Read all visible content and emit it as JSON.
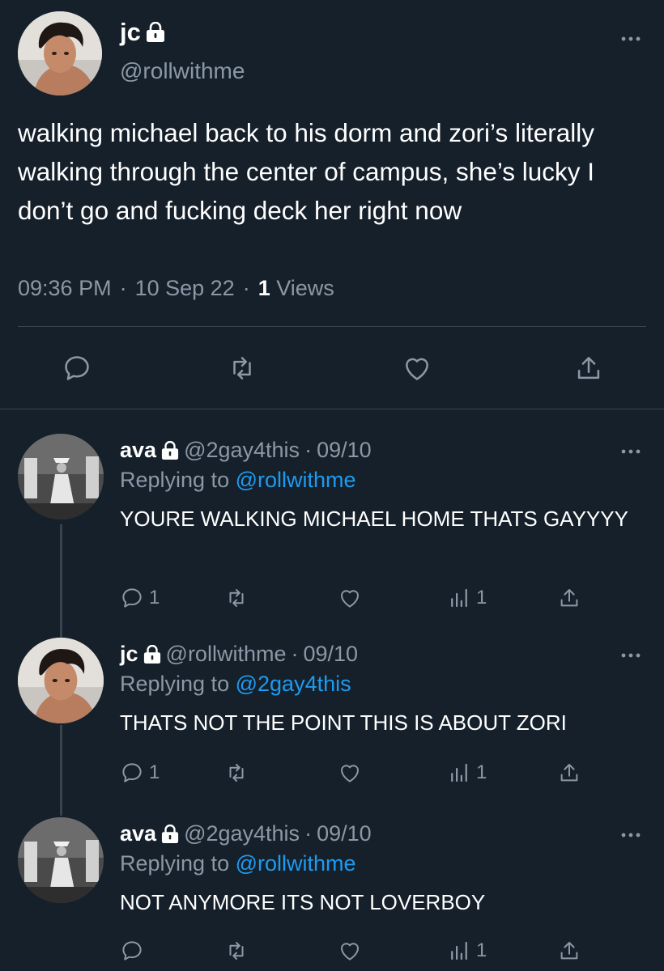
{
  "main_tweet": {
    "display_name": "jc",
    "handle": "@rollwithme",
    "text": "walking michael back to his dorm and zori’s literally walking through the center of campus, she’s lucky I don’t go and fucking deck her right now",
    "time": "09:36 PM",
    "separator": "·",
    "date": "10 Sep 22",
    "views_count": "1",
    "views_label": "Views",
    "icons": [
      "lock-icon",
      "more-icon",
      "reply-icon",
      "retweet-icon",
      "like-icon",
      "share-icon"
    ]
  },
  "replies": [
    {
      "display_name": "ava",
      "handle": "@2gay4this",
      "date": "09/10",
      "replying_prefix": "Replying to",
      "replying_to": "@rollwithme",
      "text": "YOURE WALKING MICHAEL HOME THATS GAYYYY",
      "reply_count": "1",
      "views_count": "1"
    },
    {
      "display_name": "jc",
      "handle": "@rollwithme",
      "date": "09/10",
      "replying_prefix": "Replying to",
      "replying_to": "@2gay4this",
      "text": "THATS NOT THE POINT THIS IS ABOUT ZORI",
      "reply_count": "1",
      "views_count": "1"
    },
    {
      "display_name": "ava",
      "handle": "@2gay4this",
      "date": "09/10",
      "replying_prefix": "Replying to",
      "replying_to": "@rollwithme",
      "text": "NOT ANYMORE ITS NOT LOVERBOY",
      "reply_count": "",
      "views_count": "1"
    }
  ],
  "colors": {
    "background": "#15202b",
    "text": "#ffffff",
    "secondary": "#8b98a5",
    "link": "#1d9bf0",
    "divider": "#38444d"
  }
}
